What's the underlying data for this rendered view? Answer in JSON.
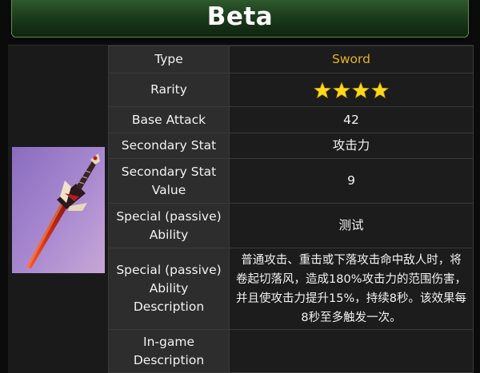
{
  "header": {
    "title": "Beta"
  },
  "weapon_image": {
    "icon": "sword-illustration",
    "colors": {
      "background": "#9a7fc4",
      "blade": "#b4261a",
      "hilt": "#2a1a1a"
    }
  },
  "stats": {
    "type_label": "Type",
    "type_value": "Sword",
    "rarity_label": "Rarity",
    "rarity_stars": 4,
    "base_attack_label": "Base Attack",
    "base_attack_value": "42",
    "secondary_stat_label": "Secondary Stat",
    "secondary_stat_value": "攻击力",
    "secondary_stat_value_label_line1": "Secondary Stat",
    "secondary_stat_value_label_line2": "Value",
    "secondary_stat_value_value": "9",
    "passive_label_line1": "Special (passive)",
    "passive_label_line2": "Ability",
    "passive_value": "测试",
    "passive_desc_label_line1": "Special (passive)",
    "passive_desc_label_line2": "Ability",
    "passive_desc_label_line3": "Description",
    "passive_desc_value": "普通攻击、重击或下落攻击命中敌人时，将卷起切落风，造成180%攻击力的范围伤害，并且使攻击力提升15%，持续8秒。该效果每8秒至多触发一次。",
    "ingame_label_line1": "In-game",
    "ingame_label_line2": "Description",
    "ingame_value": ""
  },
  "colors": {
    "accent": "#e4b41e",
    "star": "#ffd91a",
    "header_green": "#2e5a2c"
  }
}
